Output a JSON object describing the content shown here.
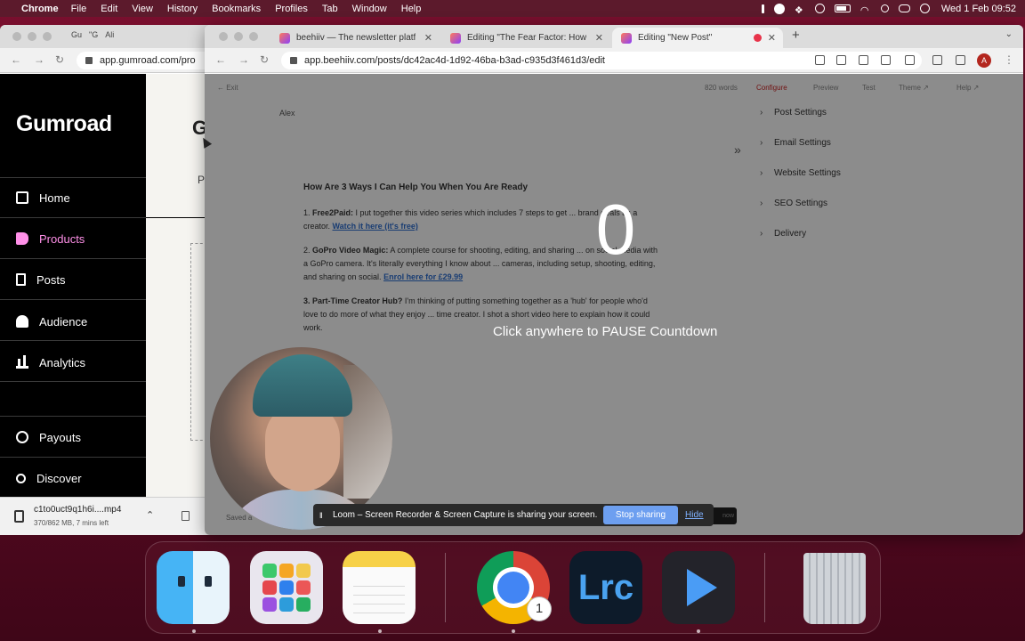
{
  "menubar": {
    "app": "Chrome",
    "items": [
      "File",
      "Edit",
      "View",
      "History",
      "Bookmarks",
      "Profiles",
      "Tab",
      "Window",
      "Help"
    ],
    "clock": "Wed 1 Feb  09:52"
  },
  "gumroad_window": {
    "tabs": [
      "Gu",
      "\"G",
      "Ali"
    ],
    "url": "app.gumroad.com/pro",
    "logo": "Gumroad",
    "page_initial": "G",
    "page_fragment": "P",
    "nav": [
      {
        "label": "Home",
        "icon": "home-icon",
        "active": false
      },
      {
        "label": "Products",
        "icon": "products-icon",
        "active": true
      },
      {
        "label": "Posts",
        "icon": "posts-icon",
        "active": false
      },
      {
        "label": "Audience",
        "icon": "audience-icon",
        "active": false
      },
      {
        "label": "Analytics",
        "icon": "analytics-icon",
        "active": false
      },
      {
        "label": "Payouts",
        "icon": "payouts-icon",
        "active": false
      },
      {
        "label": "Discover",
        "icon": "discover-icon",
        "active": false
      }
    ],
    "active_color": "#ff90e8",
    "download": {
      "filename": "c1to0uct9q1h6i....mp4",
      "meta": "370/862 MB, 7 mins left"
    }
  },
  "beehiiv_window": {
    "tabs": [
      {
        "title": "beehiiv — The newsletter platf",
        "active": false
      },
      {
        "title": "Editing \"The Fear Factor: How",
        "active": false
      },
      {
        "title": "Editing \"New Post\"",
        "active": true,
        "recording": true
      }
    ],
    "url": "app.beehiiv.com/posts/dc42ac4d-1d92-46ba-b3ad-c935d3f461d3/edit",
    "profile_initial": "A",
    "editor_header": {
      "exit": "← Exit",
      "words": "820 words",
      "tabs": [
        "Configure",
        "Preview",
        "Test",
        "Theme ↗",
        "Help ↗"
      ]
    },
    "author": "Alex",
    "article": {
      "heading": "How Are 3 Ways I Can Help You When You Are Ready",
      "item1_title": "Free2Paid:",
      "item1_text": " I put together this video series which includes 7 steps to get ... brand deals as a creator. ",
      "item1_link": "Watch it here (it's free)",
      "item2_title": "GoPro Video Magic:",
      "item2_text": " A complete course for shooting, editing, and sharing ... on social media with a GoPro camera. It's literally everything I know about ... cameras, including setup, shooting, editing, and sharing on social. ",
      "item2_link": "Enrol here for £29.99",
      "item3_title": "3. Part-Time Creator Hub?",
      "item3_text": " I'm thinking of putting something together as a 'hub' for people who'd love to do more of what they enjoy ... time creator. I shot a short video here to explain how it could work."
    },
    "settings": [
      "Post Settings",
      "Email Settings",
      "Website Settings",
      "SEO Settings",
      "Delivery"
    ],
    "saved": "Saved a",
    "dark_button": "now"
  },
  "overlay": {
    "countdown": "0",
    "hint": "Click anywhere to PAUSE Countdown"
  },
  "share_bar": {
    "message": "Loom – Screen Recorder & Screen Capture is sharing your screen.",
    "stop": "Stop sharing",
    "hide": "Hide",
    "stop_color": "#6d9ff0"
  },
  "dock": {
    "apps": [
      "Finder",
      "Launchpad",
      "Notes",
      "Chrome",
      "Lightroom Classic",
      "Player",
      "Trash"
    ],
    "chrome_badge": "1",
    "lrc_label": "Lrc"
  }
}
